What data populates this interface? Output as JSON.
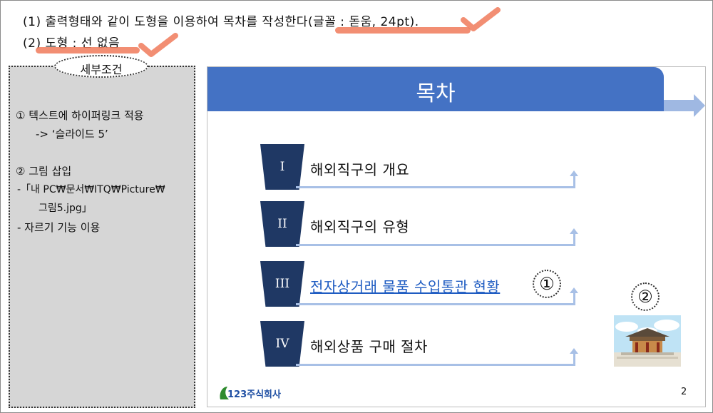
{
  "instructions": {
    "line1": "(1) 출력형태와 같이 도형을 이용하여 목차를 작성한다(글꼴 : 돋움, 24pt).",
    "line2": "(2) 도형 : 선 없음"
  },
  "panel": {
    "title": "세부조건",
    "item1_line1": "① 텍스트에 하이퍼링크 적용",
    "item1_line2": "-> ‘슬라이드 5’",
    "item2_line1": "② 그림 삽입",
    "item2_line2": "-「내 PC₩문서₩ITQ₩Picture₩",
    "item2_line3": "그림5.jpg」",
    "item2_line4": "- 자르기 기능 이용"
  },
  "slide": {
    "title": "목차",
    "items": [
      {
        "num": "I",
        "text": "해외직구의 개요"
      },
      {
        "num": "II",
        "text": "해외직구의 유형"
      },
      {
        "num": "III",
        "text": "전자상거래 물품 수입통관 현황"
      },
      {
        "num": "IV",
        "text": "해외상품 구매 절차"
      }
    ],
    "marker1": "①",
    "marker2": "②",
    "logo_text": "123주식회사",
    "page_number": "2"
  },
  "colors": {
    "header": "#4472c4",
    "number_box": "#1f3864",
    "connector": "#a8c0e6",
    "link": "#1f5cc2",
    "annotation": "#f07a5a"
  }
}
